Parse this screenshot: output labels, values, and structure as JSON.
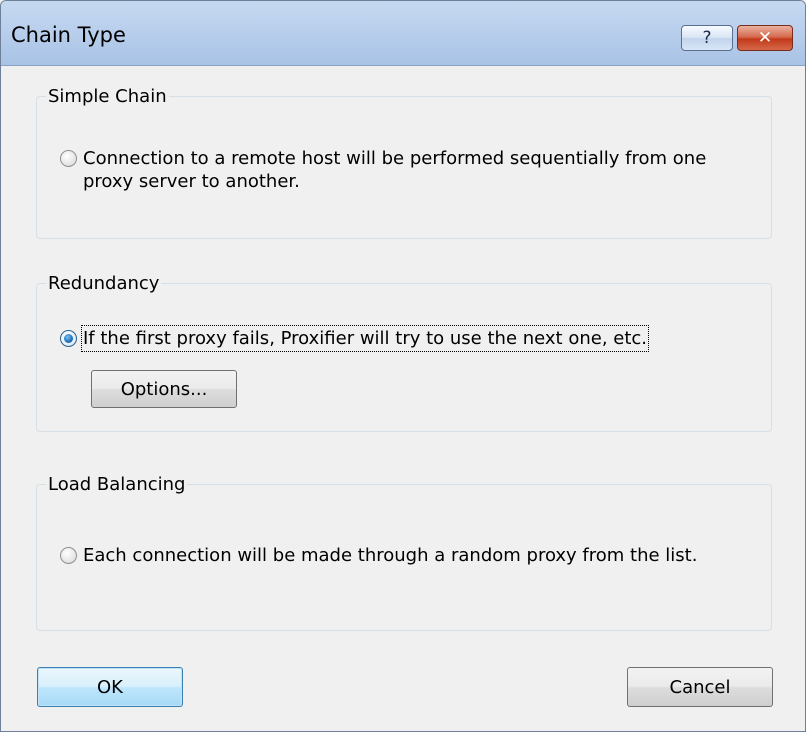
{
  "window": {
    "title": "Chain Type",
    "help_glyph": "?",
    "close_glyph": "✕"
  },
  "groups": {
    "simple": {
      "title": "Simple Chain",
      "option_text": "Connection to a remote host will be performed sequentially from one proxy server to another.",
      "checked": false
    },
    "redundancy": {
      "title": "Redundancy",
      "option_text": "If the first proxy fails, Proxifier will try to use the next one, etc.",
      "checked": true,
      "options_button": "Options..."
    },
    "load_balancing": {
      "title": "Load Balancing",
      "option_text": "Each connection will be made through a random proxy from the list.",
      "checked": false
    }
  },
  "buttons": {
    "ok": "OK",
    "cancel": "Cancel"
  },
  "icons": {
    "help": "help-icon",
    "close": "close-icon"
  },
  "colors": {
    "titlebar": "#b9cfec",
    "close_button": "#c33a1a",
    "default_button_border": "#3c7fb1"
  }
}
